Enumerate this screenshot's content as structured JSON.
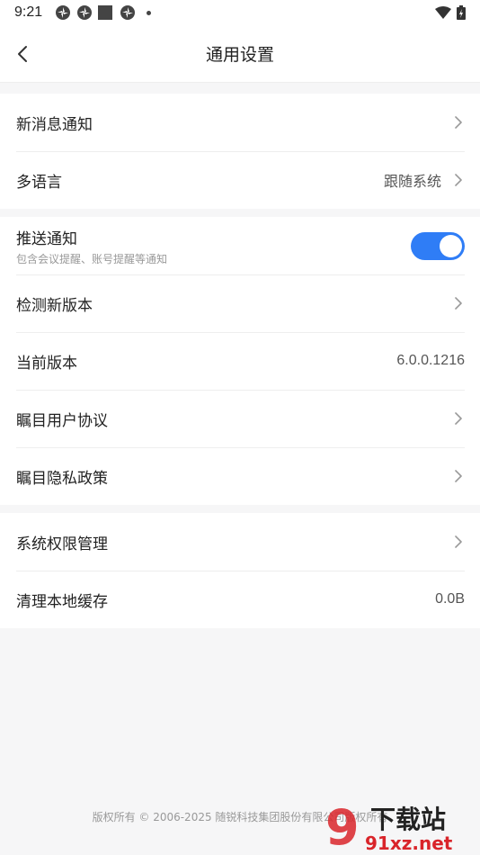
{
  "status_bar": {
    "time": "9:21",
    "icons": [
      "app-icon",
      "app-icon",
      "square-icon",
      "app-icon",
      "dot-icon"
    ],
    "right_icons": [
      "wifi-icon",
      "battery-icon"
    ]
  },
  "header": {
    "title": "通用设置",
    "back_icon": "chevron-left-icon"
  },
  "groups": [
    {
      "items": [
        {
          "label": "新消息通知",
          "value": "",
          "chevron": true
        },
        {
          "label": "多语言",
          "value": "跟随系统",
          "chevron": true
        }
      ]
    },
    {
      "items": [
        {
          "label": "推送通知",
          "sub": "包含会议提醒、账号提醒等通知",
          "toggle": true
        },
        {
          "label": "检测新版本",
          "value": "",
          "chevron": true
        },
        {
          "label": "当前版本",
          "value": "6.0.0.1216",
          "chevron": false
        },
        {
          "label": "瞩目用户协议",
          "value": "",
          "chevron": true
        },
        {
          "label": "瞩目隐私政策",
          "value": "",
          "chevron": true
        }
      ]
    },
    {
      "items": [
        {
          "label": "系统权限管理",
          "value": "",
          "chevron": true
        },
        {
          "label": "清理本地缓存",
          "value": "0.0B",
          "chevron": false
        }
      ]
    }
  ],
  "footer": {
    "copyright": "版权所有 © 2006-2025 随锐科技集团股份有限公司版权所有"
  },
  "watermark": {
    "brand": "下载站",
    "number": "9",
    "domain": "91xz.net"
  },
  "colors": {
    "accent": "#2f7df6",
    "background": "#f6f6f7",
    "watermark_red": "#d9242a"
  }
}
